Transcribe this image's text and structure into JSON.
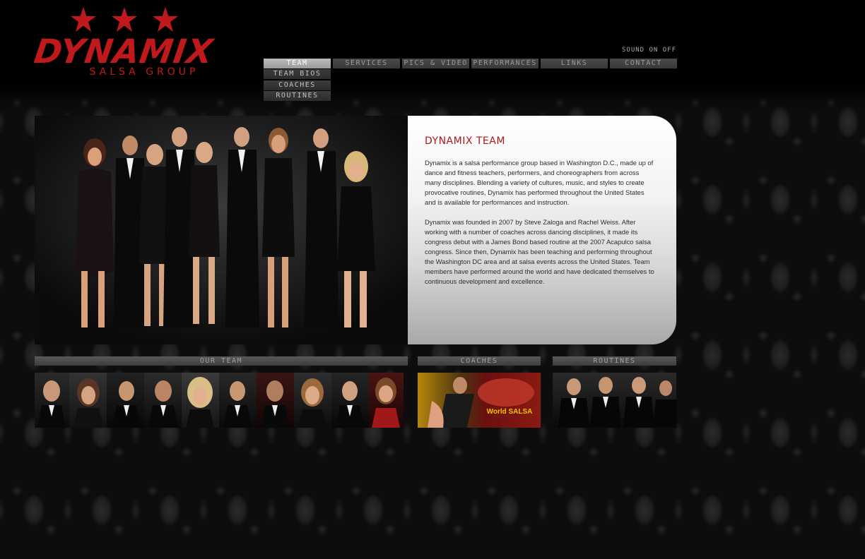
{
  "logo": {
    "wordmark": "DYNAMIX",
    "subtitle": "SALSA GROUP"
  },
  "sound": {
    "label": "SOUND ON OFF"
  },
  "nav": {
    "items": [
      "TEAM",
      "SERVICES",
      "PICS & VIDEO",
      "PERFORMANCES",
      "LINKS",
      "CONTACT"
    ],
    "active": "TEAM",
    "submenu": [
      "TEAM BIOS",
      "COACHES",
      "ROUTINES"
    ]
  },
  "panel": {
    "title": "DYNAMIX TEAM",
    "paragraph1": "Dynamix is a salsa performance group based in Washington D.C., made up of dance and fitness teachers, performers, and choreographers from across many disciplines. Blending a variety of cultures, music, and styles to create provocative routines, Dynamix has performed throughout the United States and is available for performances and instruction.",
    "paragraph2": "Dynamix was founded in 2007 by Steve Zaloga and Rachel Weiss. After working with a number of coaches across dancing disciplines, it made its congress debut with a James Bond based routine at the 2007 Acapulco salsa congress. Since then, Dynamix has been teaching and performing throughout the Washington DC area and at salsa events across the United States. Team members have performed around the world and have dedicated themselves to continuous development and excellence."
  },
  "strips": {
    "our_team": "OUR TEAM",
    "coaches": "COACHES",
    "routines": "ROUTINES",
    "coaches_badge": "World SALSA"
  },
  "colors": {
    "brand_red": "#c0191b",
    "nav_active": "#bdbdbd",
    "nav": "#444444"
  },
  "icons": [
    "star-icon",
    "star-icon",
    "star-icon"
  ]
}
